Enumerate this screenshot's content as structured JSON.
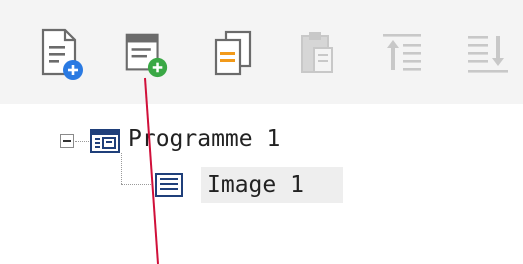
{
  "toolbar": {
    "buttons": [
      {
        "icon": "new-document-plus-icon",
        "enabled": true
      },
      {
        "icon": "new-window-plus-icon",
        "enabled": true
      },
      {
        "icon": "copy-document-icon",
        "enabled": true
      },
      {
        "icon": "paste-icon",
        "enabled": false
      },
      {
        "icon": "move-up-icon",
        "enabled": false
      },
      {
        "icon": "move-down-icon",
        "enabled": false
      }
    ]
  },
  "tree": {
    "root": {
      "label": "Programme 1",
      "icon": "programme-icon",
      "expanded": true
    },
    "children": [
      {
        "label": "Image 1",
        "icon": "image-list-icon",
        "selected": true
      }
    ]
  },
  "colors": {
    "toolbar_bg": "#f4f4f4",
    "blue_accent": "#2a7ae2",
    "green_accent": "#3aa845",
    "orange_accent": "#f29a1a",
    "disabled": "#c8c8c8",
    "pointer": "#d0103a"
  }
}
